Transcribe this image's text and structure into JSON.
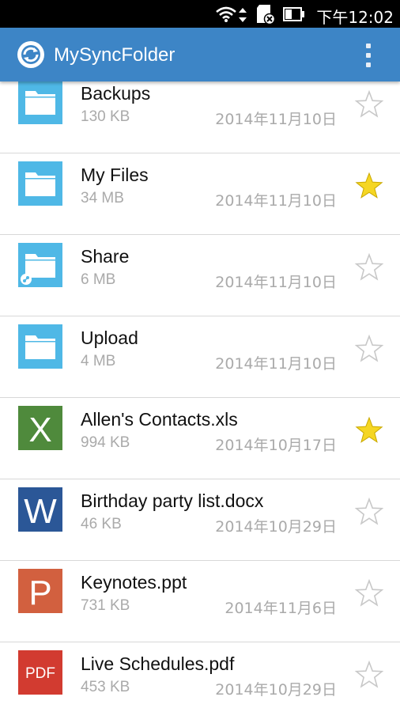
{
  "status_bar": {
    "time": "下午12:02"
  },
  "app_bar": {
    "title": "MySyncFolder"
  },
  "files": [
    {
      "name": "Backups",
      "size": "130 KB",
      "date": "2014年11月10日",
      "type": "folder",
      "starred": false
    },
    {
      "name": "My Files",
      "size": "34 MB",
      "date": "2014年11月10日",
      "type": "folder",
      "starred": true
    },
    {
      "name": "Share",
      "size": "6 MB",
      "date": "2014年11月10日",
      "type": "shared-folder",
      "starred": false
    },
    {
      "name": "Upload",
      "size": "4 MB",
      "date": "2014年11月10日",
      "type": "folder",
      "starred": false
    },
    {
      "name": "Allen's Contacts.xls",
      "size": "994 KB",
      "date": "2014年10月17日",
      "type": "excel",
      "icon_letter": "X",
      "starred": true
    },
    {
      "name": "Birthday party list.docx",
      "size": "46 KB",
      "date": "2014年10月29日",
      "type": "word",
      "icon_letter": "W",
      "starred": false
    },
    {
      "name": "Keynotes.ppt",
      "size": "731 KB",
      "date": "2014年11月6日",
      "type": "powerpoint",
      "icon_letter": "P",
      "starred": false
    },
    {
      "name": "Live Schedules.pdf",
      "size": "453 KB",
      "date": "2014年10月29日",
      "type": "pdf",
      "icon_letter": "PDF",
      "starred": false
    }
  ],
  "colors": {
    "app_bar": "#3d85c6",
    "folder": "#4fb8e6",
    "excel": "#4f8a3c",
    "word": "#2b5797",
    "powerpoint": "#d2603f",
    "pdf": "#d23b30",
    "star_on": "#f5d623",
    "star_off": "#c8c8c8"
  }
}
